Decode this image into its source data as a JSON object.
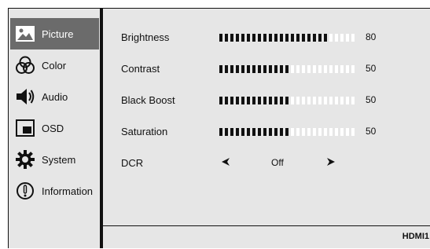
{
  "sidebar": {
    "items": [
      {
        "label": "Picture",
        "icon": "picture-icon",
        "active": true
      },
      {
        "label": "Color",
        "icon": "color-icon",
        "active": false
      },
      {
        "label": "Audio",
        "icon": "speaker-icon",
        "active": false
      },
      {
        "label": "OSD",
        "icon": "osd-icon",
        "active": false
      },
      {
        "label": "System",
        "icon": "gear-icon",
        "active": false
      },
      {
        "label": "Information",
        "icon": "info-icon",
        "active": false
      }
    ]
  },
  "settings": [
    {
      "label": "Brightness",
      "value": "80",
      "level": 0.8
    },
    {
      "label": "Contrast",
      "value": "50",
      "level": 0.5
    },
    {
      "label": "Black Boost",
      "value": "50",
      "level": 0.5
    },
    {
      "label": "Saturation",
      "value": "50",
      "level": 0.5
    }
  ],
  "dcr": {
    "label": "DCR",
    "value": "Off"
  },
  "footer": {
    "input_source": "HDMI1"
  },
  "colors": {
    "panel": "#e6e6e6",
    "active": "#6b6b6b",
    "segment_on": "#111111",
    "segment_off": "#ffffff"
  }
}
